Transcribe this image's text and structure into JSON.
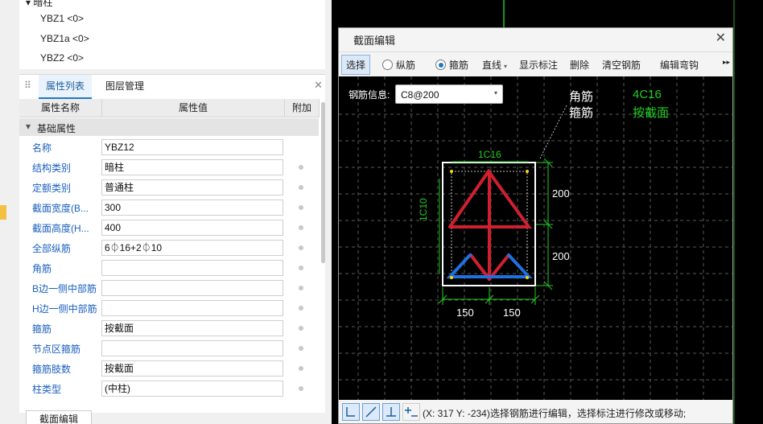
{
  "tree": {
    "parent_label": "暗柱",
    "items": [
      "YBZ1 <0>",
      "YBZ1a <0>",
      "YBZ2 <0>"
    ]
  },
  "panel": {
    "tabs": [
      "属性列表",
      "图层管理"
    ],
    "columns": [
      "属性名称",
      "属性值",
      "附加"
    ],
    "group": "基础属性",
    "rows": [
      {
        "name": "名称",
        "value": "YBZ12"
      },
      {
        "name": "结构类别",
        "value": "暗柱"
      },
      {
        "name": "定额类别",
        "value": "普通柱"
      },
      {
        "name": "截面宽度(B...",
        "value": "300"
      },
      {
        "name": "截面高度(H...",
        "value": "400"
      },
      {
        "name": "全部纵筋",
        "value": "6⏀16+2⏀10"
      },
      {
        "name": "角筋",
        "value": ""
      },
      {
        "name": "B边一侧中部筋",
        "value": ""
      },
      {
        "name": "H边一侧中部筋",
        "value": ""
      },
      {
        "name": "箍筋",
        "value": "按截面"
      },
      {
        "name": "节点区箍筋",
        "value": ""
      },
      {
        "name": "箍筋肢数",
        "value": "按截面"
      },
      {
        "name": "柱类型",
        "value": "(中柱)"
      }
    ],
    "bottom_tab": "截面编辑"
  },
  "dialog": {
    "title": "截面编辑",
    "toolbar": {
      "select": "选择",
      "longitudinal": "纵筋",
      "stirrup": "箍筋",
      "line": "直线",
      "show_label": "显示标注",
      "delete": "删除",
      "clear": "清空钢筋",
      "edit_hook": "编辑弯钩"
    },
    "rebar_info_label": "钢筋信息:",
    "rebar_info_value": "C8@200",
    "canvas": {
      "corner_label": "角筋",
      "stirrup_label": "箍筋",
      "corner_value": "4C16",
      "stirrup_value": "按截面",
      "top_bar": "1C16",
      "side_bar": "1C10",
      "dim_h1": "200",
      "dim_h2": "200",
      "dim_w1": "150",
      "dim_w2": "150"
    },
    "status": "(X: 317 Y: -234)选择钢筋进行编辑，选择标注进行修改或移动;"
  }
}
